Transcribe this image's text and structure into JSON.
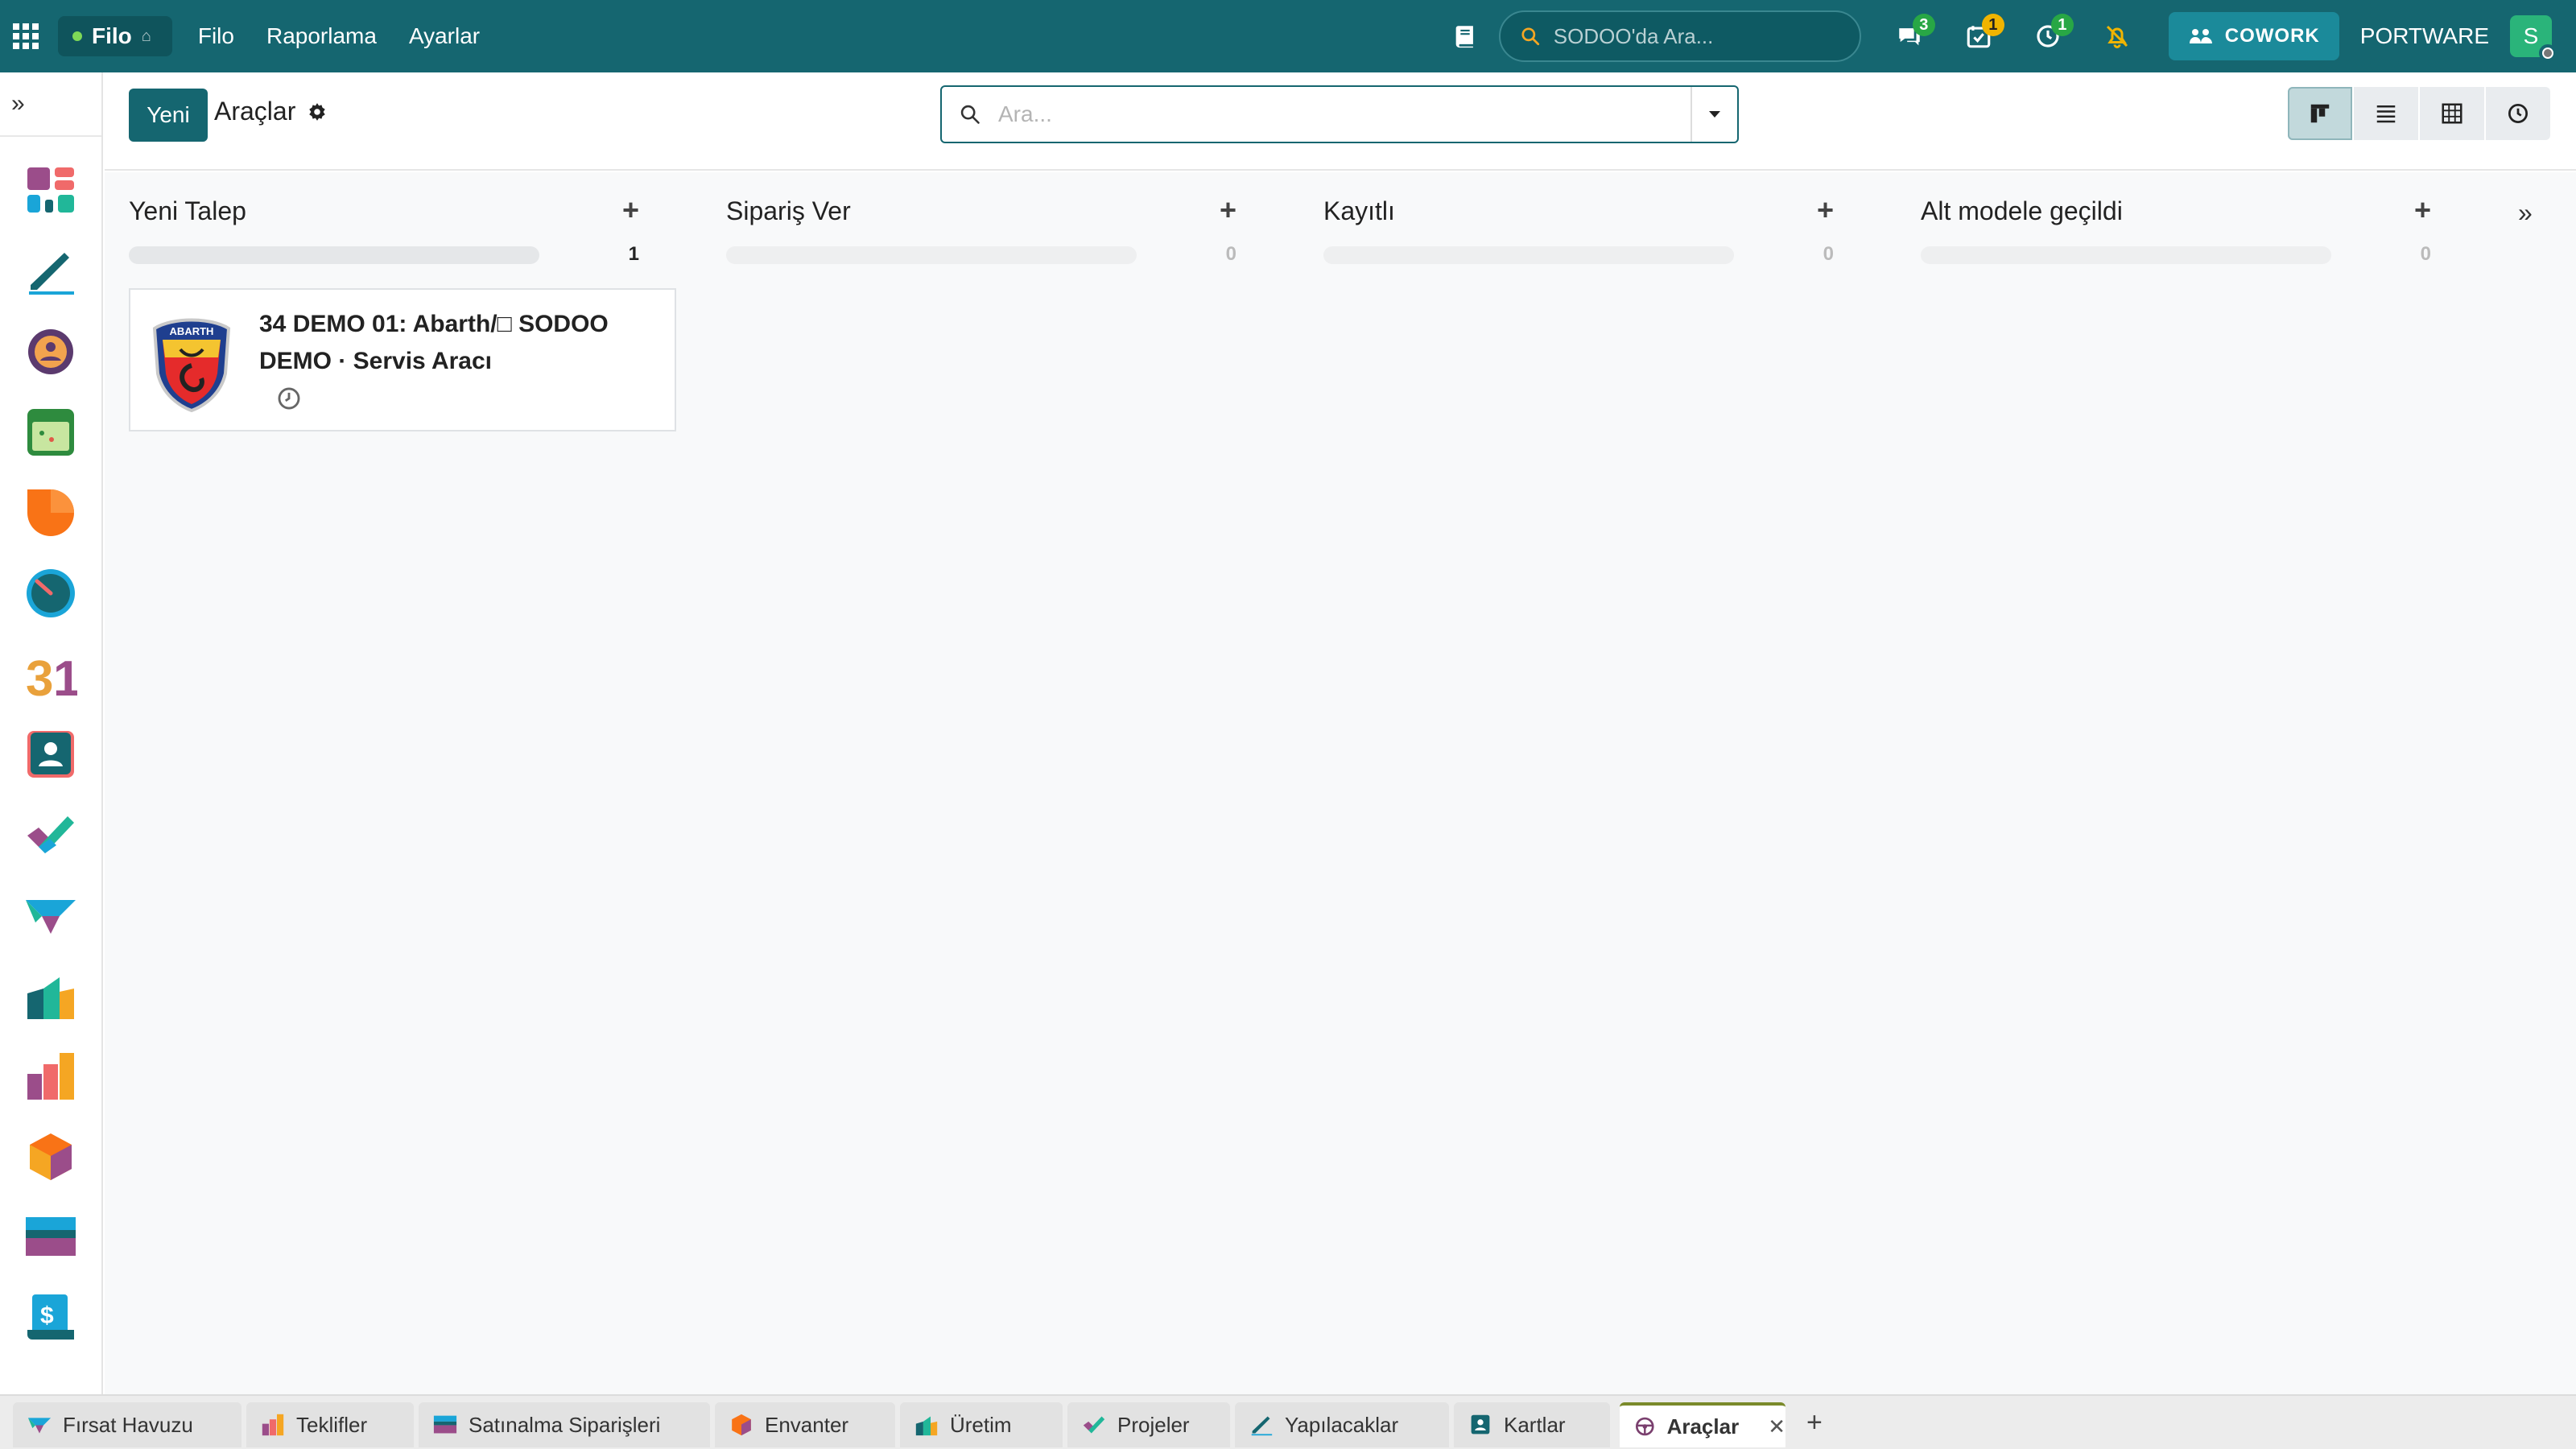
{
  "navbar": {
    "app_name": "Filo",
    "menu": [
      "Filo",
      "Raporlama",
      "Ayarlar"
    ],
    "global_search_placeholder": "SODOO'da Ara...",
    "badges": {
      "messages": "3",
      "activities": "1",
      "timer": "1"
    },
    "cowork_label": "COWORK",
    "company": "PORTWARE",
    "avatar_initial": "S"
  },
  "control_panel": {
    "new_button": "Yeni",
    "title": "Araçlar",
    "search_placeholder": "Ara..."
  },
  "kanban": {
    "columns": [
      {
        "title": "Yeni Talep",
        "count": "1"
      },
      {
        "title": "Sipariş Ver",
        "count": "0"
      },
      {
        "title": "Kayıtlı",
        "count": "0"
      },
      {
        "title": "Alt modele geçildi",
        "count": "0"
      }
    ],
    "card": {
      "title_line1": "34 DEMO 01: Abarth/□ SODOO",
      "title_line2": "DEMO · Servis Aracı",
      "logo_text": "ABARTH"
    }
  },
  "bottom_tabs": [
    {
      "label": "Fırsat Havuzu"
    },
    {
      "label": "Teklifler"
    },
    {
      "label": "Satınalma Siparişleri"
    },
    {
      "label": "Envanter"
    },
    {
      "label": "Üretim"
    },
    {
      "label": "Projeler"
    },
    {
      "label": "Yapılacaklar"
    },
    {
      "label": "Kartlar"
    },
    {
      "label": "Araçlar",
      "active": true
    }
  ],
  "colors": {
    "primary": "#156670",
    "navbar": "#156670",
    "background": "#f8f9fa"
  }
}
